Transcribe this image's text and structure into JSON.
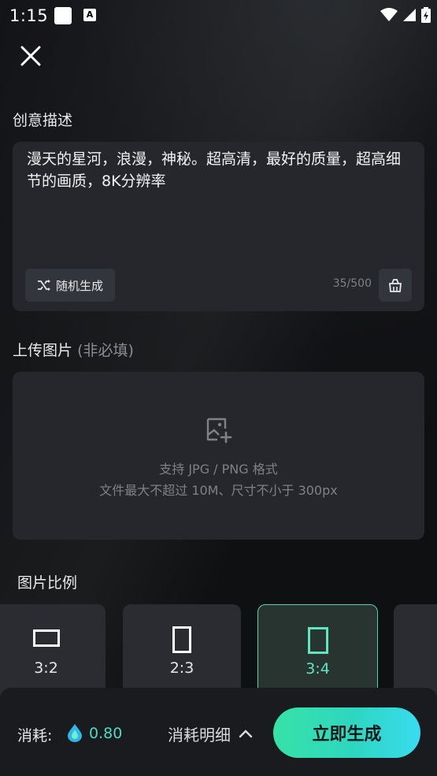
{
  "status_bar": {
    "time": "1:15",
    "notif_icon": "A"
  },
  "header": {
    "close_icon": "close-icon"
  },
  "creative": {
    "title": "创意描述",
    "description": "漫天的星河，浪漫，神秘。超高清，最好的质量，超高细节的画质，8K分辨率",
    "random_label": "随机生成",
    "counter": "35/500"
  },
  "upload": {
    "title": "上传图片",
    "optional": "(非必填)",
    "line1": "支持 JPG / PNG 格式",
    "line2": "文件最大不超过 10M、尺寸不小于 300px"
  },
  "ratio": {
    "title": "图片比例",
    "options": [
      {
        "label": "3:2",
        "selected": false
      },
      {
        "label": "2:3",
        "selected": false
      },
      {
        "label": "3:4",
        "selected": true
      },
      {
        "label": "",
        "selected": false
      }
    ]
  },
  "footer": {
    "cost_label": "消耗:",
    "cost_value": "0.80",
    "detail_label": "消耗明细",
    "generate_label": "立即生成"
  },
  "colors": {
    "accent": "#47d9b4",
    "cost": "#4fd9c2"
  }
}
